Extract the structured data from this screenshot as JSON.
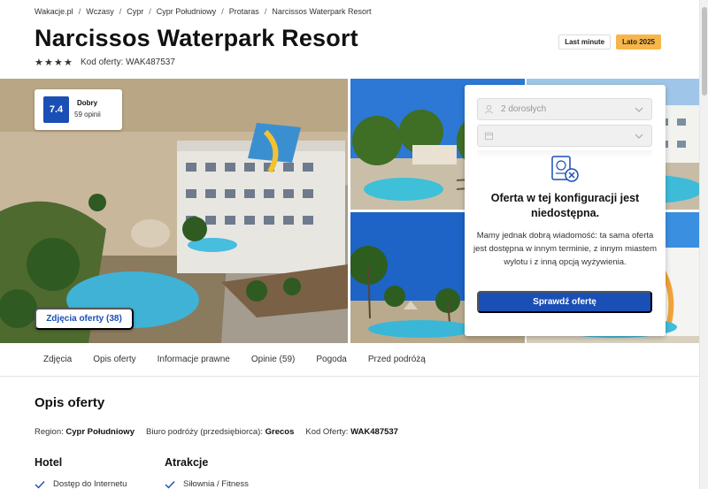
{
  "breadcrumb": [
    "Wakacje.pl",
    "Wczasy",
    "Cypr",
    "Cypr Południowy",
    "Protaras",
    "Narcissos Waterpark Resort"
  ],
  "hotel": {
    "title": "Narcissos Waterpark Resort",
    "stars": 4,
    "offer_code_label": "Kod oferty: WAK487537"
  },
  "tags": [
    "Last minute",
    "Lato 2025"
  ],
  "score": {
    "value": "7.4",
    "label": "Dobry",
    "count": "59 opinii"
  },
  "photos_button": "Zdjęcia oferty (38)",
  "offer_panel": {
    "guests_value": "2 dorosłych",
    "date_value": "",
    "title": "Oferta w tej konfiguracji jest niedostępna.",
    "text": "Mamy jednak dobrą wiadomość: ta sama oferta jest dostępna w innym terminie, z innym miastem wylotu i z inną opcją wyżywienia.",
    "button": "Sprawdź ofertę"
  },
  "tabs": [
    "Zdjęcia",
    "Opis oferty",
    "Informacje prawne",
    "Opinie (59)",
    "Pogoda",
    "Przed podróżą"
  ],
  "description": {
    "title": "Opis oferty",
    "region_label": "Region:",
    "region_value": "Cypr Południowy",
    "bureau_label": "Biuro podróży (przedsiębiorca):",
    "bureau_value": "Grecos",
    "code_label": "Kod Oferty:",
    "code_value": "WAK487537"
  },
  "hotel_section": {
    "title": "Hotel",
    "first_item": "Dostęp do Internetu"
  },
  "attractions_section": {
    "title": "Atrakcje",
    "first_item": "Siłownia / Fitness"
  },
  "colors": {
    "accent": "#1a4fb5",
    "tag_orange": "#f7b64a"
  },
  "icons": {
    "star": "star-icon",
    "user": "user-icon",
    "calendar": "calendar-icon",
    "chevron": "chevron-down-icon",
    "unavailable": "passport-unavailable-icon",
    "check": "check-icon"
  }
}
